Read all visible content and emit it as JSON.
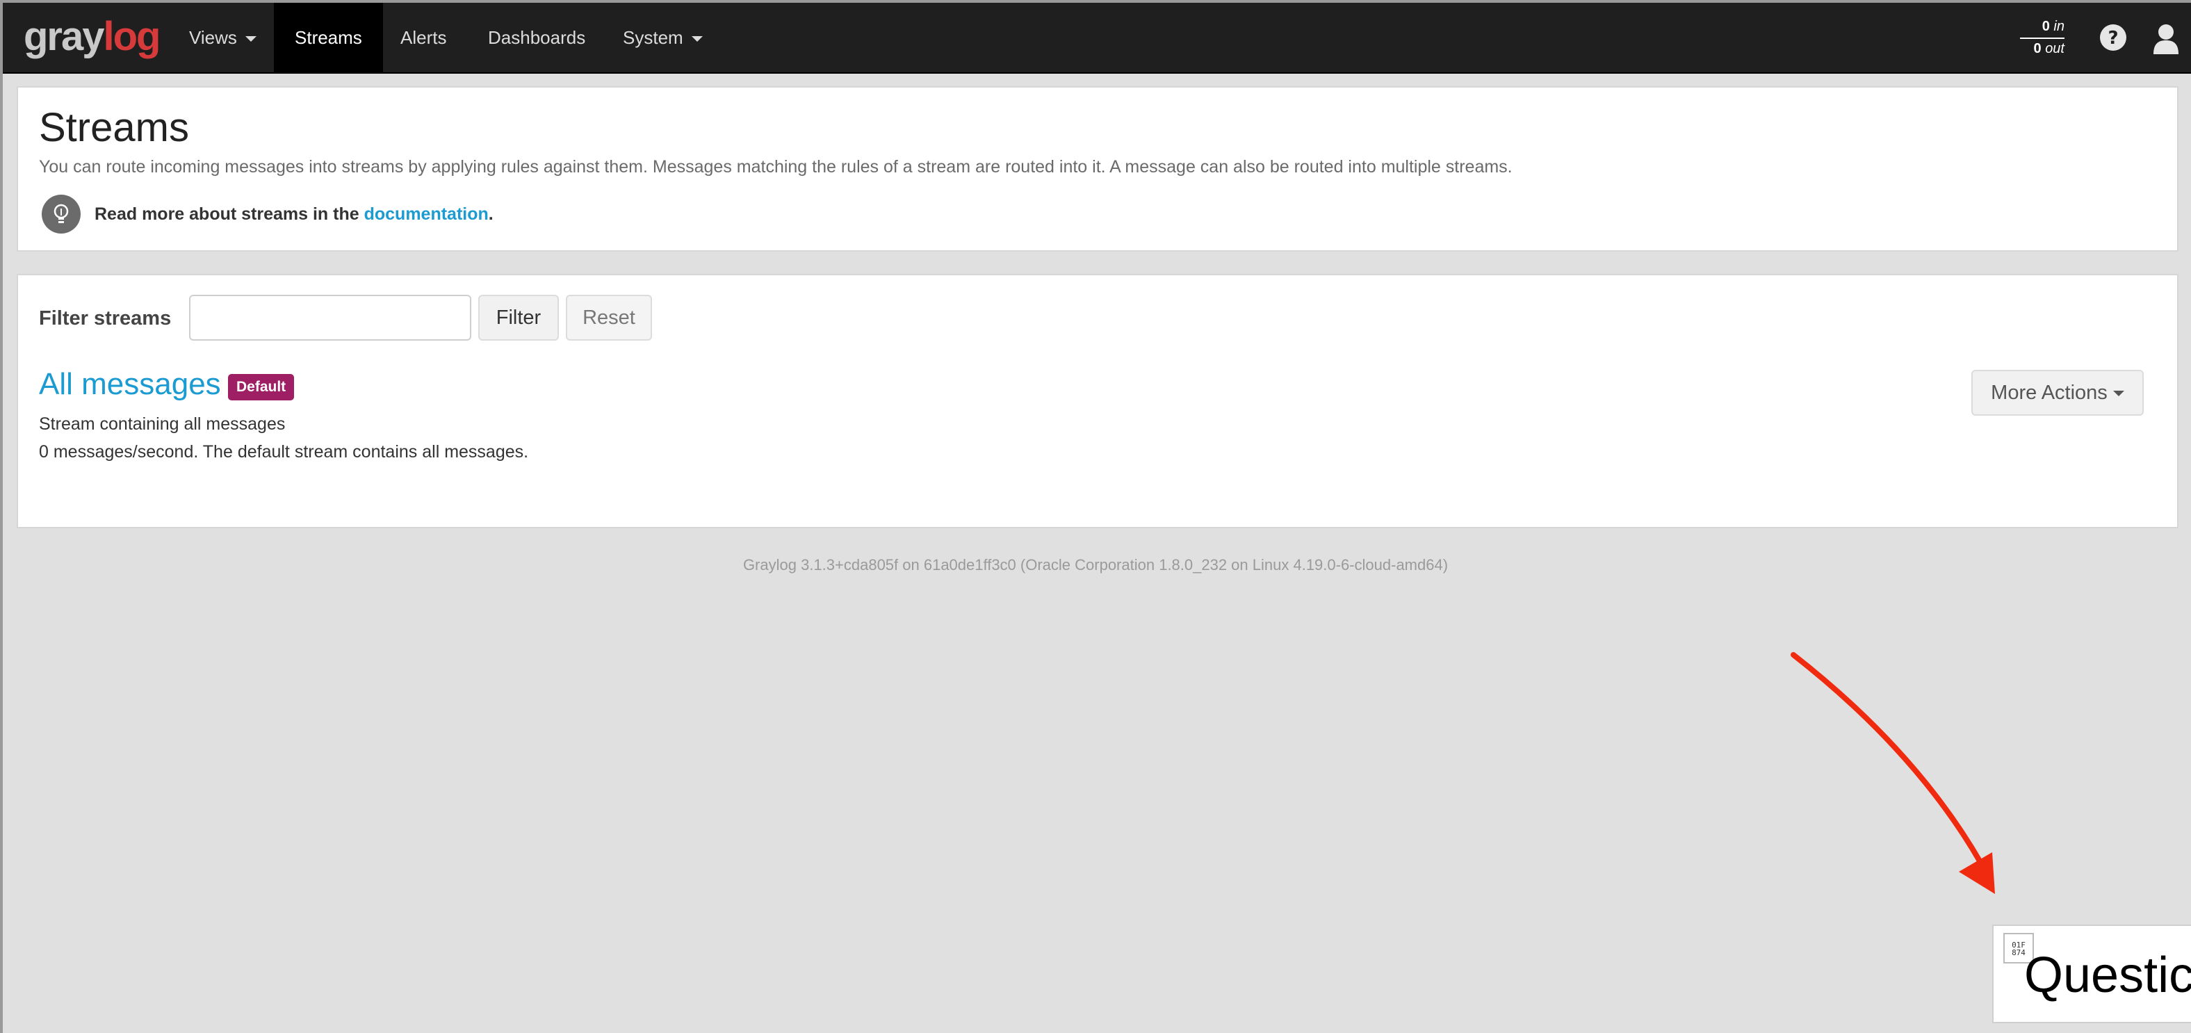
{
  "navbar": {
    "logo": {
      "part1": "gray",
      "part2": "log"
    },
    "items": [
      {
        "label": "Views",
        "dropdown": true
      },
      {
        "label": "Streams",
        "active": true
      },
      {
        "label": "Alerts"
      },
      {
        "label": "Dashboards"
      },
      {
        "label": "System",
        "dropdown": true
      }
    ],
    "throughput": {
      "in_value": "0",
      "in_label": "in",
      "out_value": "0",
      "out_label": "out"
    },
    "icons": [
      "help-icon",
      "user-icon"
    ]
  },
  "header": {
    "title": "Streams",
    "description": "You can route incoming messages into streams by applying rules against them. Messages matching the rules of a stream are routed into it. A message can also be routed into multiple streams.",
    "hint_prefix": "Read more about streams in the ",
    "hint_link": "documentation",
    "hint_suffix": "."
  },
  "filter": {
    "label": "Filter streams",
    "input_value": "",
    "filter_button": "Filter",
    "reset_button": "Reset"
  },
  "streams": [
    {
      "title": "All messages",
      "badge": "Default",
      "description": "Stream containing all messages",
      "rate": "0 messages/second. The default stream contains all messages.",
      "actions_button": "More Actions"
    }
  ],
  "footer": "Graylog 3.1.3+cda805f on 61a0de1ff3c0 (Oracle Corporation 1.8.0_232 on Linux 4.19.0-6-cloud-amd64)",
  "overlay": {
    "question_text": "Questic",
    "qr_text": "01F\n874",
    "arrow_color": "#f02a0f"
  },
  "colors": {
    "navbar_bg": "#1f1f1f",
    "link_blue": "#1b9bd1",
    "badge_purple": "#9e1f63",
    "logo_red": "#d63a3a"
  }
}
